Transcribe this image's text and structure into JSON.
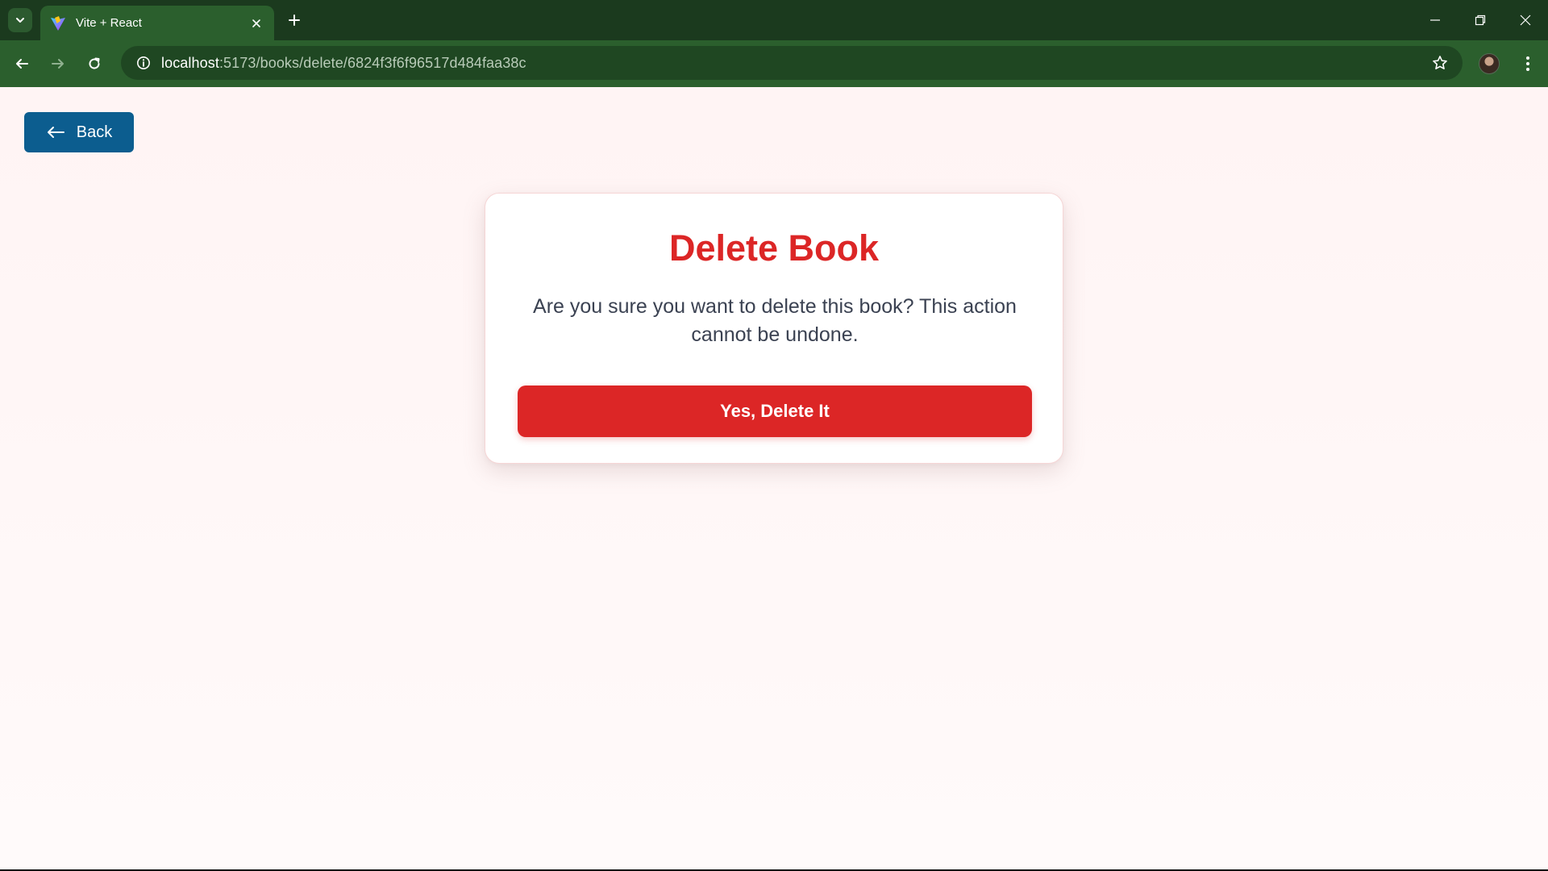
{
  "browser": {
    "tab": {
      "title": "Vite + React"
    },
    "address": {
      "host": "localhost",
      "path": ":5173/books/delete/6824f3f6f96517d484faa38c"
    },
    "icons": {
      "tab_search": "chevron-down-icon",
      "tab_close": "close-icon",
      "new_tab": "plus-icon",
      "back": "arrow-left-icon",
      "forward": "arrow-right-icon",
      "reload": "reload-icon",
      "site_info": "info-icon",
      "bookmark": "star-icon",
      "menu": "kebab-menu-icon"
    },
    "colors": {
      "tabbar": "#1b3a1e",
      "toolbar": "#2b5f2d"
    }
  },
  "page": {
    "back_button": {
      "label": "Back",
      "icon": "arrow-left-icon",
      "color": "#0c5d8f"
    },
    "dialog": {
      "title": "Delete Book",
      "message": "Are you sure you want to delete this book? This action cannot be undone.",
      "confirm_label": "Yes, Delete It",
      "accent_color": "#dc2626"
    }
  }
}
